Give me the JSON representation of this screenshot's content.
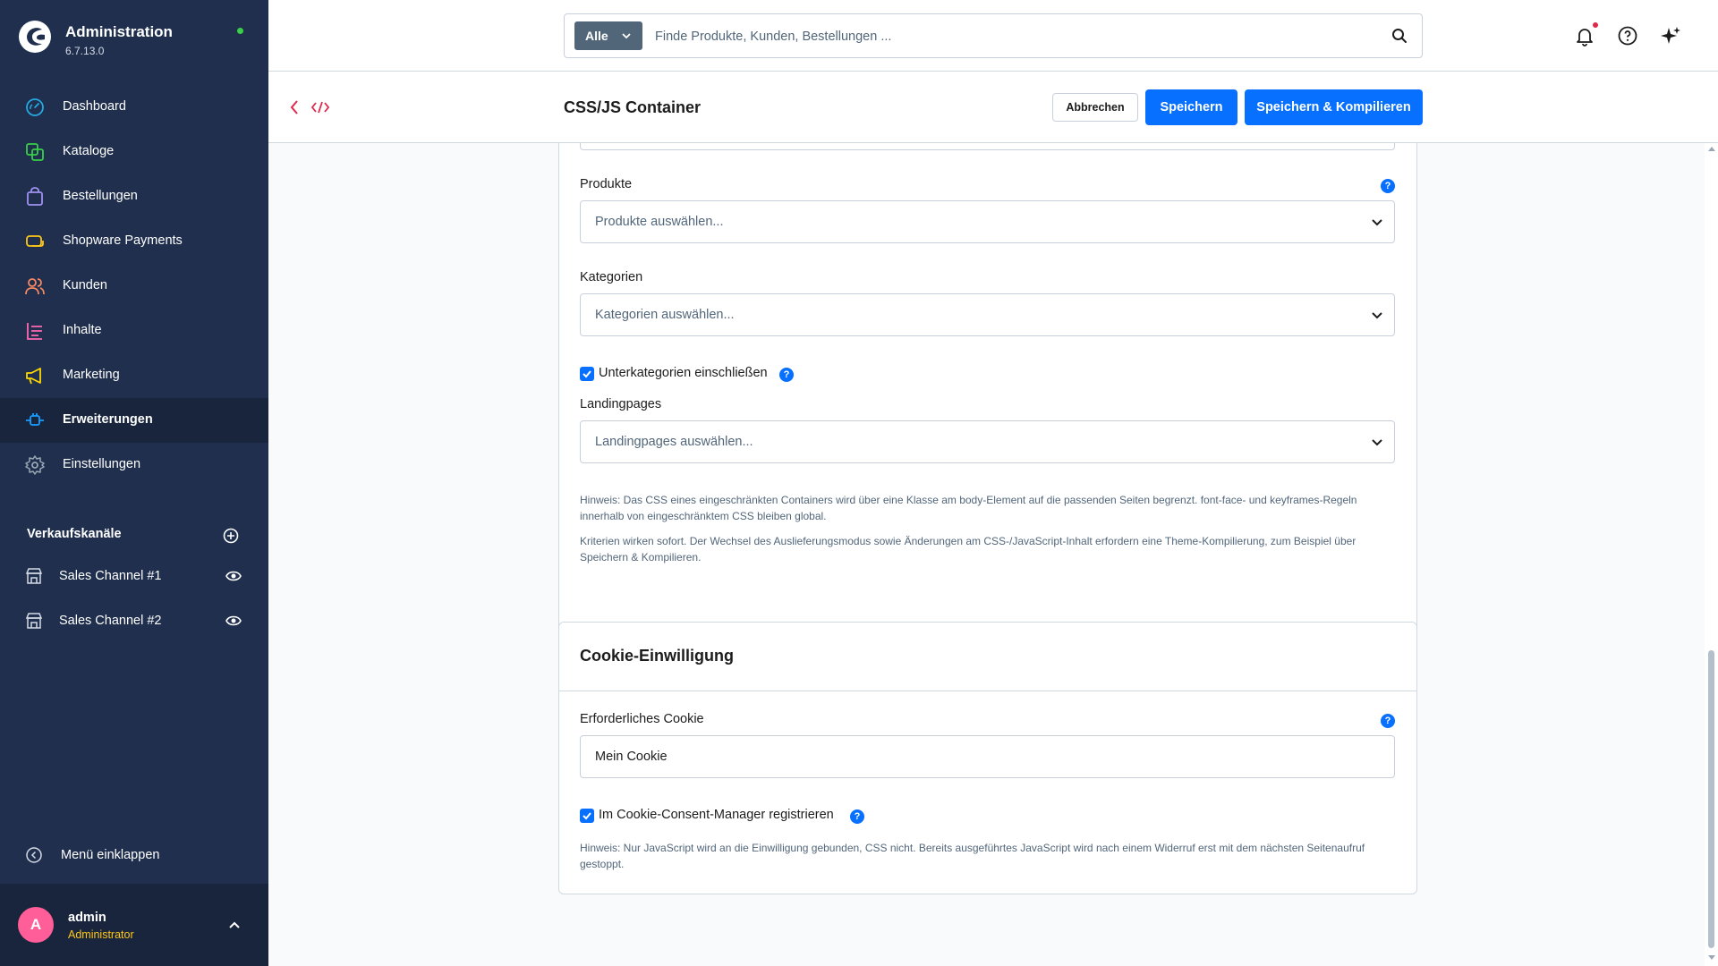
{
  "app": {
    "title": "Administration",
    "version": "6.7.13.0"
  },
  "sidebar": {
    "items": [
      {
        "label": "Dashboard",
        "icon": "gauge-icon",
        "color": "#26a9e0"
      },
      {
        "label": "Kataloge",
        "icon": "products-icon",
        "color": "#37d046"
      },
      {
        "label": "Bestellungen",
        "icon": "shopping-bag-icon",
        "color": "#a092f0"
      },
      {
        "label": "Shopware Payments",
        "icon": "payment-icon",
        "color": "#ffc61a"
      },
      {
        "label": "Kunden",
        "icon": "users-icon",
        "color": "#f88962"
      },
      {
        "label": "Inhalte",
        "icon": "content-icon",
        "color": "#ff68b4"
      },
      {
        "label": "Marketing",
        "icon": "megaphone-icon",
        "color": "#ffd700"
      },
      {
        "label": "Erweiterungen",
        "icon": "plug-icon",
        "color": "#189eff",
        "active": true
      },
      {
        "label": "Einstellungen",
        "icon": "gear-icon",
        "color": "#9aa8b5"
      }
    ],
    "sales_channels_title": "Verkaufskanäle",
    "sales_channels": [
      {
        "label": "Sales Channel #1"
      },
      {
        "label": "Sales Channel #2"
      }
    ],
    "collapse_label": "Menü einklappen",
    "user": {
      "initial": "A",
      "name": "admin",
      "role": "Administrator"
    }
  },
  "search": {
    "type_label": "Alle",
    "placeholder": "Finde Produkte, Kunden, Bestellungen ..."
  },
  "smartbar": {
    "title": "CSS/JS Container",
    "cancel_label": "Abbrechen",
    "save_label": "Speichern",
    "save_compile_label": "Speichern & Kompilieren"
  },
  "form": {
    "products": {
      "label": "Produkte",
      "placeholder": "Produkte auswählen..."
    },
    "categories": {
      "label": "Kategorien",
      "placeholder": "Kategorien auswählen..."
    },
    "include_subcategories": {
      "label": "Unterkategorien einschließen",
      "checked": true
    },
    "landingpages": {
      "label": "Landingpages",
      "placeholder": "Landingpages auswählen..."
    },
    "hint1": "Hinweis: Das CSS eines eingeschränkten Containers wird über eine Klasse am body-Element auf die passenden Seiten begrenzt. font-face- und keyframes-Regeln innerhalb von eingeschränktem CSS bleiben global.",
    "hint2": "Kriterien wirken sofort. Der Wechsel des Auslieferungsmodus sowie Änderungen am CSS-/JavaScript-Inhalt erfordern eine Theme-Kompilierung, zum Beispiel über Speichern & Kompilieren."
  },
  "cookie": {
    "title": "Cookie-Einwilligung",
    "required_cookie_label": "Erforderliches Cookie",
    "required_cookie_value": "Mein Cookie",
    "register_label": "Im Cookie-Consent-Manager registrieren",
    "register_checked": true,
    "hint": "Hinweis: Nur JavaScript wird an die Einwilligung gebunden, CSS nicht. Bereits ausgeführtes JavaScript wird nach einem Widerruf erst mit dem nächsten Seitenaufruf gestoppt."
  },
  "colors": {
    "primary": "#0870ff",
    "sidebar_bg": "#1f2f4d",
    "notification": "#de294c",
    "online": "#37d046"
  }
}
